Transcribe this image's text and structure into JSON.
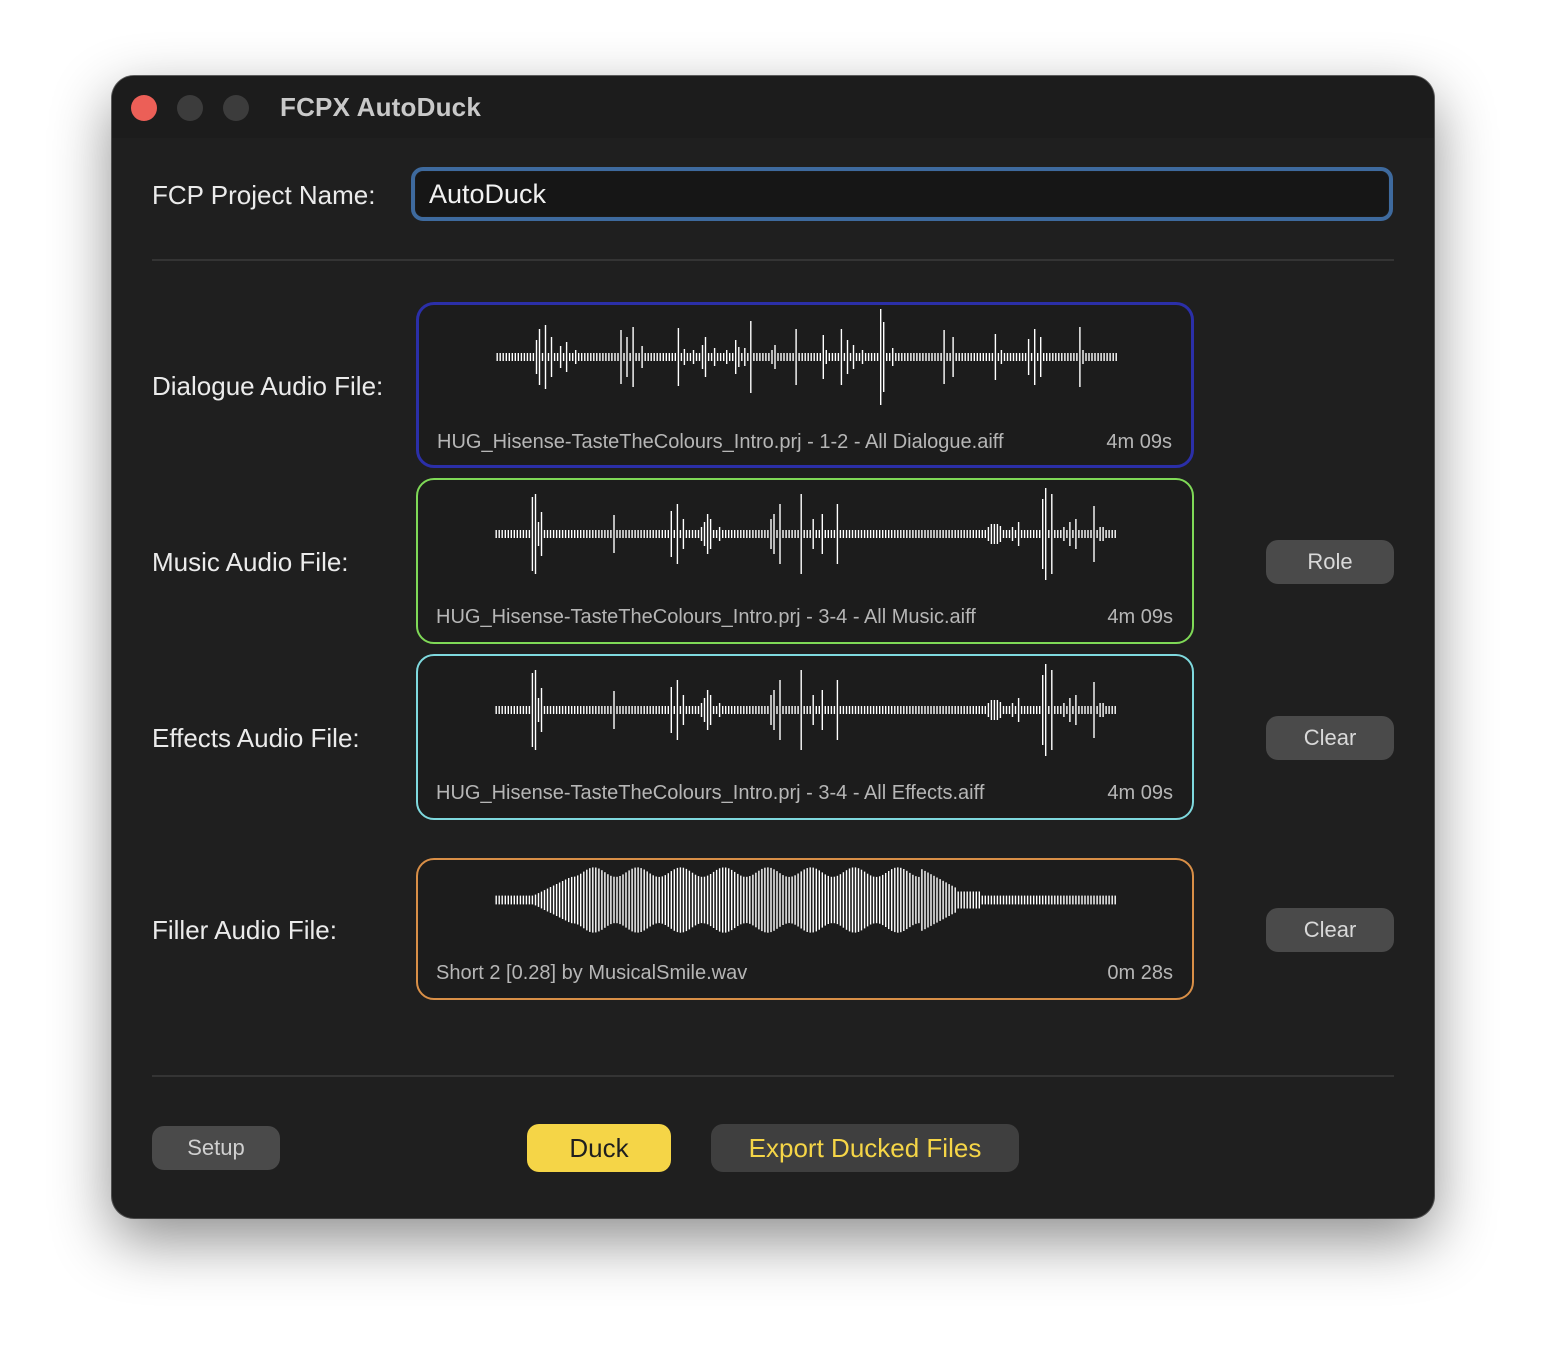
{
  "window": {
    "title": "FCPX AutoDuck"
  },
  "project": {
    "label": "FCP Project Name:",
    "value": "AutoDuck"
  },
  "tracks": [
    {
      "label": "Dialogue Audio File:",
      "file_name": "HUG_Hisense-TasteTheColours_Intro.prj - 1-2 - All Dialogue.aiff",
      "duration": "4m 09s",
      "border_color": "#2b2fa8"
    },
    {
      "label": "Music Audio File:",
      "file_name": "HUG_Hisense-TasteTheColours_Intro.prj - 3-4 - All Music.aiff",
      "duration": "4m 09s",
      "border_color": "#7fd957",
      "button": "Role"
    },
    {
      "label": "Effects Audio File:",
      "file_name": "HUG_Hisense-TasteTheColours_Intro.prj - 3-4 - All Effects.aiff",
      "duration": "4m 09s",
      "border_color": "#7fd9de",
      "button": "Clear"
    },
    {
      "label": "Filler Audio File:",
      "file_name": "Short 2 [0.28] by MusicalSmile.wav",
      "duration": "0m 28s",
      "border_color": "#d98f47",
      "button": "Clear"
    }
  ],
  "footer": {
    "setup_label": "Setup",
    "duck_label": "Duck",
    "export_label": "Export Ducked Files"
  },
  "colors": {
    "accent_yellow": "#f5d547",
    "window_bg": "#1f1f1f",
    "input_focus": "#3e6a9e",
    "close_button": "#ec5f57"
  }
}
